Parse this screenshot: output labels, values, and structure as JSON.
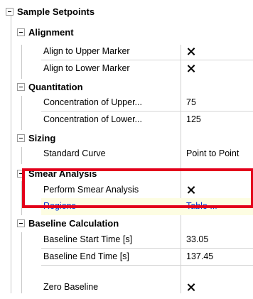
{
  "root": {
    "label": "Sample Setpoints"
  },
  "groups": {
    "alignment": {
      "label": "Alignment",
      "props": [
        {
          "name": "Align to Upper Marker",
          "checked": true
        },
        {
          "name": "Align to Lower Marker",
          "checked": true
        }
      ]
    },
    "quantitation": {
      "label": "Quantitation",
      "props": [
        {
          "name": "Concentration of Upper...",
          "value": "75"
        },
        {
          "name": "Concentration of Lower...",
          "value": "125"
        }
      ]
    },
    "sizing": {
      "label": "Sizing",
      "props": [
        {
          "name": "Standard Curve",
          "value": "Point to Point"
        }
      ]
    },
    "smear": {
      "label": "Smear Analysis",
      "props": [
        {
          "name": "Perform Smear Analysis",
          "checked": true
        },
        {
          "name": "Regions",
          "value": "Table ..."
        }
      ]
    },
    "baseline": {
      "label": "Baseline Calculation",
      "props": [
        {
          "name": "Baseline Start Time [s]",
          "value": "33.05"
        },
        {
          "name": "Baseline End Time [s]",
          "value": "137.45"
        },
        {
          "name": "Zero Baseline",
          "checked": true
        }
      ]
    }
  },
  "colors": {
    "highlight_box": "#e3001b",
    "link_text": "#0033cc",
    "selected_row": "#fdfde2"
  }
}
